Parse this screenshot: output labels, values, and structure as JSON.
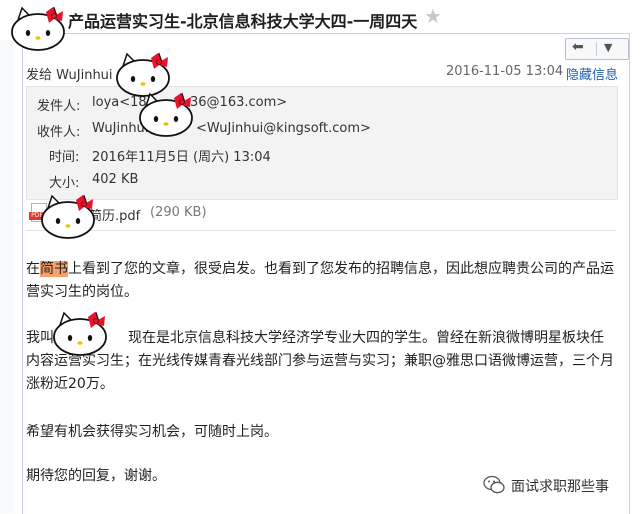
{
  "subject": "产品运营实习生-北京信息科技大学大四-一周四天",
  "header": {
    "send_to_line": "发给 WuJinhui",
    "date": "2016-11-05 13:04",
    "hide_info": "隐藏信息"
  },
  "details": {
    "from_label": "发件人:",
    "from_value": "loya<185",
    "from_value_end": "36@163.com>",
    "to_label": "收件人:",
    "to_value": "WuJinhui",
    "to_value_end": "<WuJinhui@kingsoft.com>",
    "time_label": "时间:",
    "time_value": "2016年11月5日 (周六) 13:04",
    "size_label": "大小:",
    "size_value": "402 KB"
  },
  "attachment": {
    "badge": "PDF",
    "name": "简历.pdf",
    "size": "(290 KB)"
  },
  "body": {
    "p1_a": "在",
    "p1_highlight": "简书",
    "p1_b": "上看到了您的文章，很受启发。也看到了您发布的招聘信息，因此想应聘贵公司的产品运营实习生的岗位。",
    "p2_a": "我叫",
    "p2_b": "现在是北京信息科技大学经济学专业大四的学生。曾经在新浪微博明星板块任内容运营实习生；在光线传媒青春光线部门参与运营与实习；兼职@雅思口语微博运营，三个月涨粉近20万。",
    "p3": "希望有机会获得实习机会，可随时上岗。",
    "p4": "期待您的回复，谢谢。"
  },
  "watermark": "面试求职那些事",
  "colors": {
    "link": "#1f5fb0",
    "highlight": "#f6a16a",
    "sticker_bow": "#e8132b"
  },
  "stickers": [
    "hello-kitty-sticker"
  ]
}
